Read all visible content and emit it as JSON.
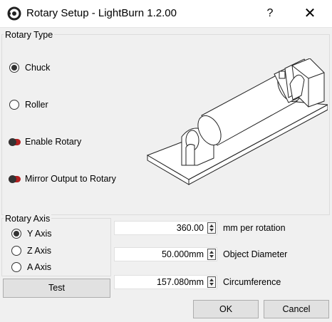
{
  "window": {
    "title": "Rotary Setup - LightBurn 1.2.00",
    "help": "?",
    "close": "✕"
  },
  "rotary_type": {
    "title": "Rotary Type",
    "chuck_label": "Chuck",
    "roller_label": "Roller",
    "selected": "Chuck",
    "enable_label": "Enable Rotary",
    "mirror_label": "Mirror Output to Rotary"
  },
  "rotary_axis": {
    "title": "Rotary Axis",
    "options": [
      "Y Axis",
      "Z Axis",
      "A Axis"
    ],
    "selected": "Y Axis"
  },
  "fields": {
    "mm_per_rotation": {
      "value": "360.00",
      "label": "mm per rotation"
    },
    "object_diameter": {
      "value": "50.000mm",
      "label": "Object Diameter"
    },
    "circumference": {
      "value": "157.080mm",
      "label": "Circumference"
    }
  },
  "buttons": {
    "test": "Test",
    "ok": "OK",
    "cancel": "Cancel"
  },
  "colors": {
    "toggle_off": "#b22020",
    "background": "#f0f0f0",
    "button": "#e1e1e1"
  }
}
